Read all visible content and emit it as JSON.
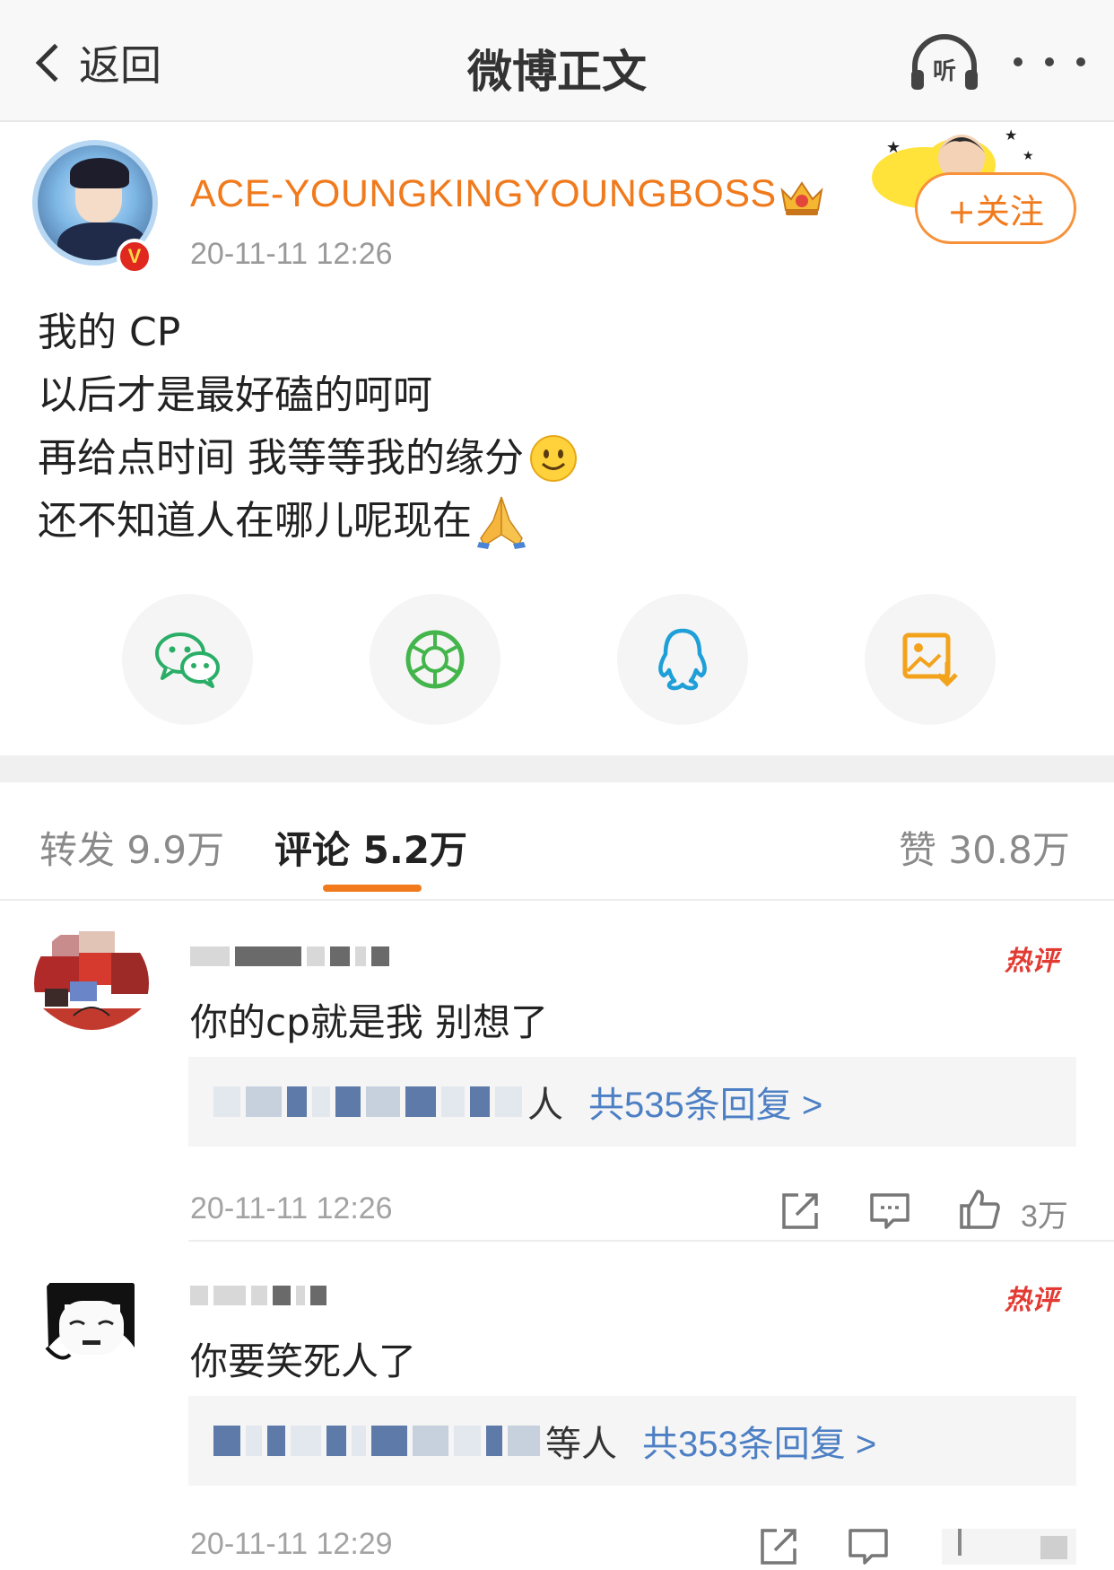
{
  "navbar": {
    "back_label": "返回",
    "title": "微博正文",
    "listen_label": "听"
  },
  "post": {
    "username": "ACE-YOUNGKINGYOUNGBOSS",
    "time": "20-11-11 12:26",
    "follow_label": "+关注",
    "lines": [
      "我的 CP",
      "以后才是最好磕的呵呵",
      "再给点时间 我等等我的缘分",
      "还不知道人在哪儿呢现在"
    ],
    "emoji_line3": "smile-emoji",
    "emoji_line4": "folded-hands-emoji"
  },
  "share": {
    "items": [
      "wechat-icon",
      "moments-icon",
      "qq-icon",
      "save-image-icon"
    ],
    "colors": {
      "wechat": "#2aae67",
      "moments": "#43b54b",
      "qq": "#1e9fd8",
      "save": "#f3a21c"
    }
  },
  "tabs": {
    "repost": "转发 9.9万",
    "comments": "评论 5.2万",
    "likes": "赞 30.8万",
    "accent": "#f07a1c"
  },
  "comments": [
    {
      "hot_label": "热评",
      "text": "你的cp就是我 别想了",
      "reply_suffix": "人",
      "reply_count": "共535条回复 >",
      "time": "20-11-11 12:26",
      "likes": "3万"
    },
    {
      "hot_label": "热评",
      "text": "你要笑死人了",
      "reply_suffix": "等人",
      "reply_count": "共353条回复 >",
      "time": "20-11-11 12:29"
    }
  ]
}
